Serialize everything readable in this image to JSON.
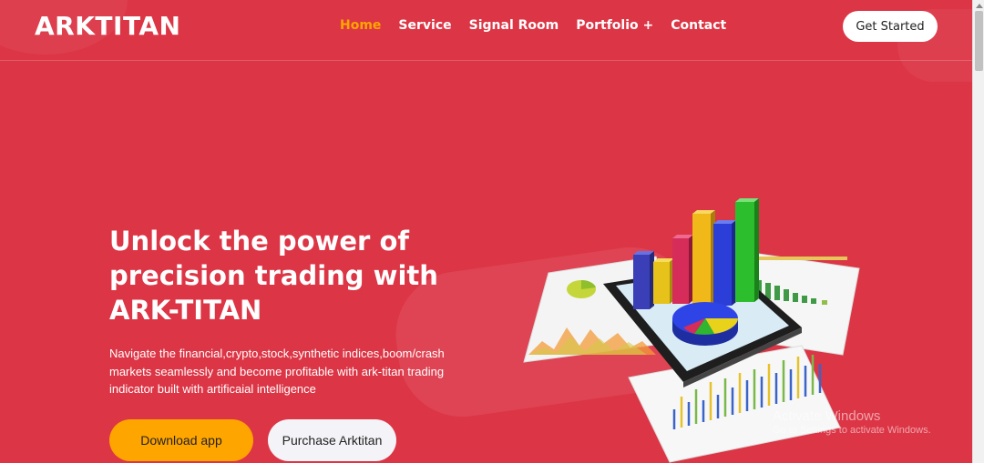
{
  "header": {
    "logo": "ARKTITAN",
    "nav": {
      "home": "Home",
      "service": "Service",
      "signal_room": "Signal Room",
      "portfolio": "Portfolio +",
      "contact": "Contact"
    },
    "cta_label": "Get Started"
  },
  "hero": {
    "title_line1": "Unlock the power of",
    "title_line2": "precision trading with",
    "title_line3": "ARK-TITAN",
    "desc_line1": "Navigate the financial,crypto,stock,synthetic indices,boom/crash",
    "desc_line2": "markets seamlessly and become profitable with ark-titan trading",
    "desc_line3": "indicator built with artificaial intelligence",
    "download_label": "Download app",
    "purchase_label": "Purchase Arktitan",
    "image_icon": "tablet-3d-bar-chart-illustration"
  },
  "watermark": {
    "title": "Activate Windows",
    "subtitle": "Go to Settings to activate Windows."
  },
  "colors": {
    "background": "#dc3545",
    "accent": "#ffa500",
    "text": "#ffffff"
  }
}
